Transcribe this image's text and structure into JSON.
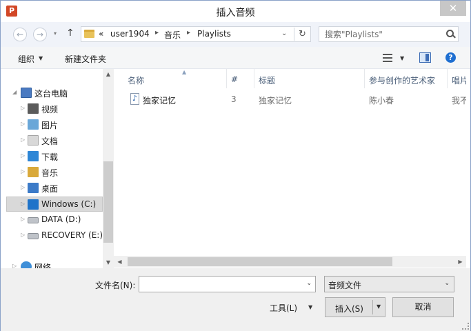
{
  "window": {
    "title": "插入音频",
    "app_icon": "P",
    "close": "✕"
  },
  "nav": {
    "back": "←",
    "forward": "→",
    "up": "↑",
    "recent_drop": "▾"
  },
  "address": {
    "overflow": "«",
    "crumbs": [
      "user1904",
      "音乐",
      "Playlists"
    ],
    "sep": "▸",
    "drop": "⌄",
    "refresh": "↻"
  },
  "search": {
    "placeholder": "搜索\"Playlists\""
  },
  "toolbar": {
    "organize": "组织",
    "organize_drop": "▼",
    "new_folder": "新建文件夹",
    "view_drop": "▼",
    "help": "?"
  },
  "tree": {
    "items": [
      {
        "label": "这台电脑",
        "icon": "computer-icon"
      },
      {
        "label": "视频",
        "icon": "videos-folder-icon"
      },
      {
        "label": "图片",
        "icon": "pictures-folder-icon"
      },
      {
        "label": "文档",
        "icon": "documents-folder-icon"
      },
      {
        "label": "下载",
        "icon": "downloads-folder-icon"
      },
      {
        "label": "音乐",
        "icon": "music-folder-icon"
      },
      {
        "label": "桌面",
        "icon": "desktop-folder-icon"
      },
      {
        "label": "Windows (C:)",
        "icon": "windows-drive-icon"
      },
      {
        "label": "DATA (D:)",
        "icon": "drive-icon"
      },
      {
        "label": "RECOVERY (E:)",
        "icon": "drive-icon"
      },
      {
        "label": "网络",
        "icon": "network-icon"
      }
    ],
    "arrow_collapsed": "▷",
    "arrow_expanded": "◢",
    "scroll_up": "▲",
    "scroll_down": "▼"
  },
  "columns": [
    {
      "label": "名称"
    },
    {
      "label": "#"
    },
    {
      "label": "标题"
    },
    {
      "label": "参与创作的艺术家"
    },
    {
      "label": "唱片"
    }
  ],
  "sort_indicator": "▲",
  "files": [
    {
      "name": "独家记忆",
      "number": "3",
      "title": "独家记忆",
      "artist": "陈小春",
      "album": "我不"
    }
  ],
  "hscroll": {
    "left": "◀",
    "right": "▶"
  },
  "bottom": {
    "filename_label": "文件名(N):",
    "filename_value": "",
    "filename_drop": "⌄",
    "filetype": "音频文件",
    "filetype_drop": "⌄",
    "tools": "工具(L)",
    "tools_drop": "▼",
    "insert": "插入(S)",
    "insert_drop": "▼",
    "cancel": "取消"
  }
}
